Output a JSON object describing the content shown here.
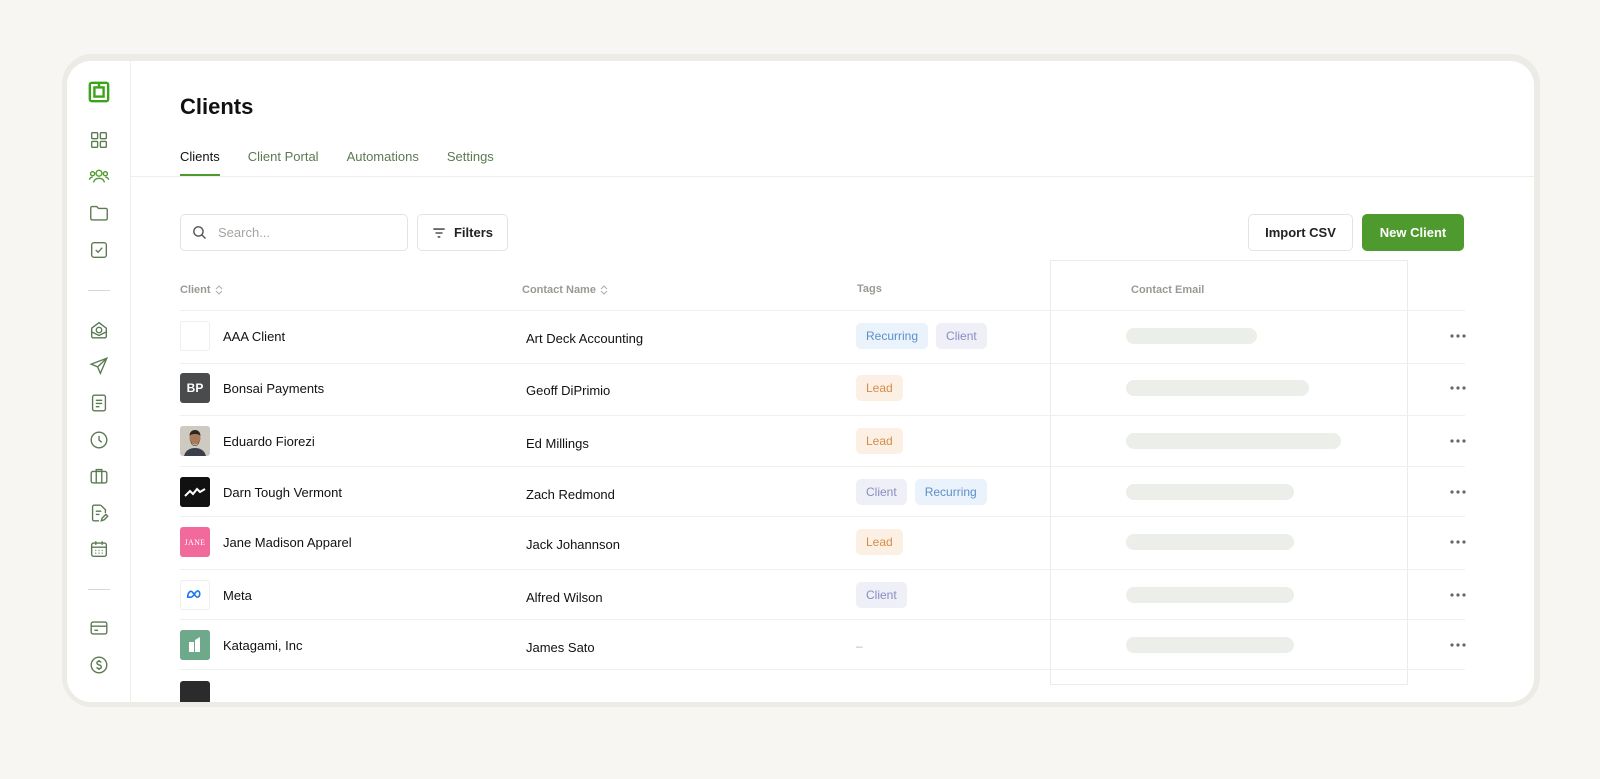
{
  "page": {
    "title": "Clients"
  },
  "tabs": [
    {
      "label": "Clients",
      "active": true
    },
    {
      "label": "Client Portal",
      "active": false
    },
    {
      "label": "Automations",
      "active": false
    },
    {
      "label": "Settings",
      "active": false
    }
  ],
  "toolbar": {
    "search_placeholder": "Search...",
    "filters_label": "Filters",
    "import_label": "Import CSV",
    "new_label": "New Client"
  },
  "table": {
    "headers": {
      "client": "Client",
      "contact": "Contact Name",
      "tags": "Tags",
      "email": "Contact Email"
    },
    "rows": [
      {
        "client": "AAA Client",
        "contact": "Art Deck Accounting",
        "tags": [
          "Recurring",
          "Client"
        ],
        "avatar": "blank",
        "email_fill": 0.45
      },
      {
        "client": "Bonsai Payments",
        "contact": "Geoff DiPrimio",
        "tags": [
          "Lead"
        ],
        "avatar": "BP",
        "email_fill": 0.63
      },
      {
        "client": "Eduardo Fiorezi",
        "contact": "Ed Millings",
        "tags": [
          "Lead"
        ],
        "avatar": "photo",
        "email_fill": 0.74
      },
      {
        "client": "Darn Tough Vermont",
        "contact": "Zach Redmond",
        "tags": [
          "Client",
          "Recurring"
        ],
        "avatar": "mountain",
        "email_fill": 0.58
      },
      {
        "client": "Jane Madison Apparel",
        "contact": "Jack Johannson",
        "tags": [
          "Lead"
        ],
        "avatar": "JANE",
        "email_fill": 0.58
      },
      {
        "client": "Meta",
        "contact": "Alfred Wilson",
        "tags": [
          "Client"
        ],
        "avatar": "meta",
        "email_fill": 0.58
      },
      {
        "client": "Katagami, Inc",
        "contact": "James Sato",
        "tags": [],
        "no_tag": "–",
        "avatar": "katagami",
        "email_fill": 0.58
      }
    ]
  },
  "colors": {
    "accent": "#4f9a2f",
    "sidebar_icon": "#5b7a52",
    "recurring": "#5d8fc9",
    "client": "#8a8cc2",
    "lead": "#d68c49"
  },
  "sidebar": {
    "items": [
      {
        "icon": "logo-icon"
      },
      {
        "icon": "dashboard-icon"
      },
      {
        "icon": "clients-icon",
        "active": true
      },
      {
        "icon": "folder-icon"
      },
      {
        "icon": "task-icon"
      },
      {
        "icon": "invoice-icon"
      },
      {
        "icon": "send-icon"
      },
      {
        "icon": "document-icon"
      },
      {
        "icon": "clock-icon"
      },
      {
        "icon": "briefcase-icon"
      },
      {
        "icon": "contract-icon"
      },
      {
        "icon": "calendar-icon"
      },
      {
        "icon": "card-icon"
      },
      {
        "icon": "dollar-icon"
      }
    ]
  }
}
